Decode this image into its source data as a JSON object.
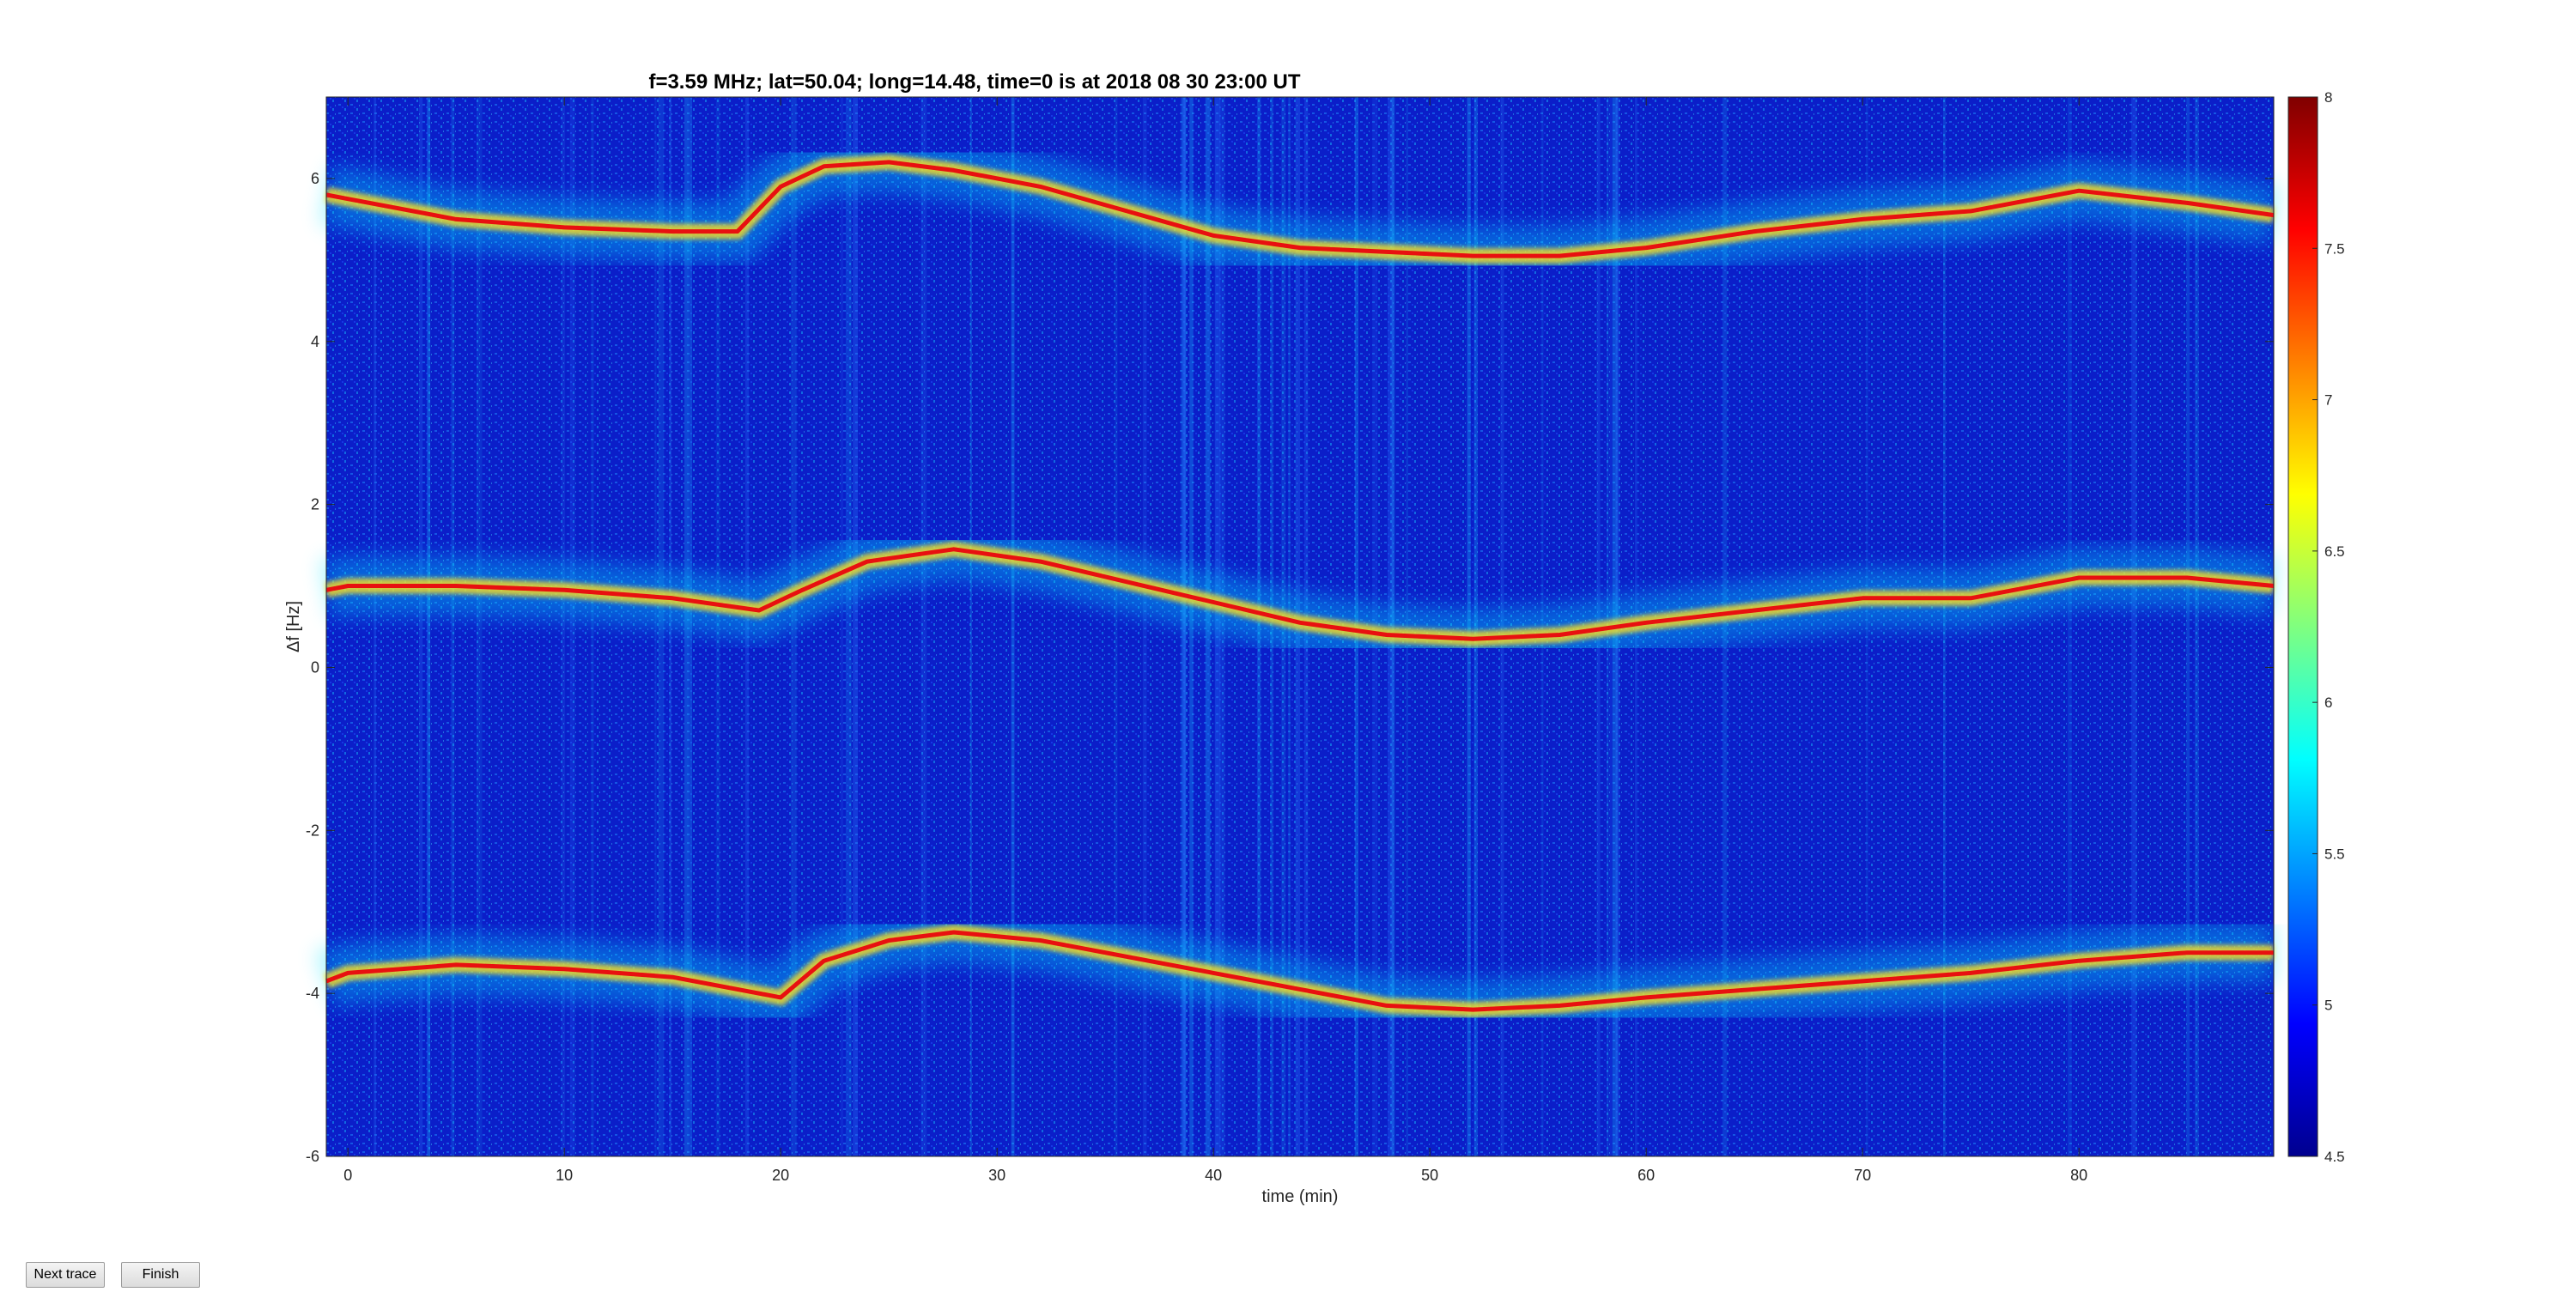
{
  "chart_data": {
    "type": "heatmap",
    "title": "f=3.59 MHz;  lat=50.04; long=14.48, time=0 is at 2018 08 30 23:00 UT",
    "xlabel": "time (min)",
    "ylabel": "Δf [Hz]",
    "xlim": [
      -1,
      89
    ],
    "ylim": [
      -6,
      7
    ],
    "xticks": [
      0,
      10,
      20,
      30,
      40,
      50,
      60,
      70,
      80
    ],
    "yticks": [
      -6,
      -4,
      -2,
      0,
      2,
      4,
      6
    ],
    "grid": false,
    "colorbar": {
      "colormap": "jet",
      "range": [
        4.5,
        8
      ],
      "ticks": [
        "4.5",
        "5",
        "5.5",
        "6",
        "6.5",
        "7",
        "7.5",
        "8"
      ]
    },
    "traces": [
      {
        "x": [
          -1,
          0,
          5,
          10,
          15,
          18,
          20,
          22,
          25,
          28,
          32,
          36,
          40,
          44,
          48,
          52,
          56,
          60,
          65,
          70,
          75,
          80,
          85,
          89
        ],
        "y": [
          5.8,
          5.75,
          5.5,
          5.4,
          5.35,
          5.35,
          5.9,
          6.15,
          6.2,
          6.1,
          5.9,
          5.6,
          5.3,
          5.15,
          5.1,
          5.05,
          5.05,
          5.15,
          5.35,
          5.5,
          5.6,
          5.85,
          5.7,
          5.55
        ]
      },
      {
        "x": [
          -1,
          0,
          5,
          10,
          15,
          19,
          21,
          24,
          28,
          32,
          36,
          40,
          44,
          48,
          52,
          56,
          60,
          65,
          70,
          75,
          80,
          85,
          89
        ],
        "y": [
          0.95,
          1.0,
          1.0,
          0.95,
          0.85,
          0.7,
          0.95,
          1.3,
          1.45,
          1.3,
          1.05,
          0.8,
          0.55,
          0.4,
          0.35,
          0.4,
          0.55,
          0.7,
          0.85,
          0.85,
          1.1,
          1.1,
          1.0
        ]
      },
      {
        "x": [
          -1,
          0,
          5,
          10,
          15,
          18,
          20,
          22,
          25,
          28,
          32,
          36,
          40,
          44,
          48,
          52,
          56,
          60,
          65,
          70,
          75,
          80,
          85,
          89
        ],
        "y": [
          -3.85,
          -3.75,
          -3.65,
          -3.7,
          -3.8,
          -3.95,
          -4.05,
          -3.6,
          -3.35,
          -3.25,
          -3.35,
          -3.55,
          -3.75,
          -3.95,
          -4.15,
          -4.2,
          -4.15,
          -4.05,
          -3.95,
          -3.85,
          -3.75,
          -3.6,
          -3.5,
          -3.5
        ]
      }
    ]
  },
  "controls": {
    "next_label": "Next trace",
    "finish_label": "Finish"
  }
}
